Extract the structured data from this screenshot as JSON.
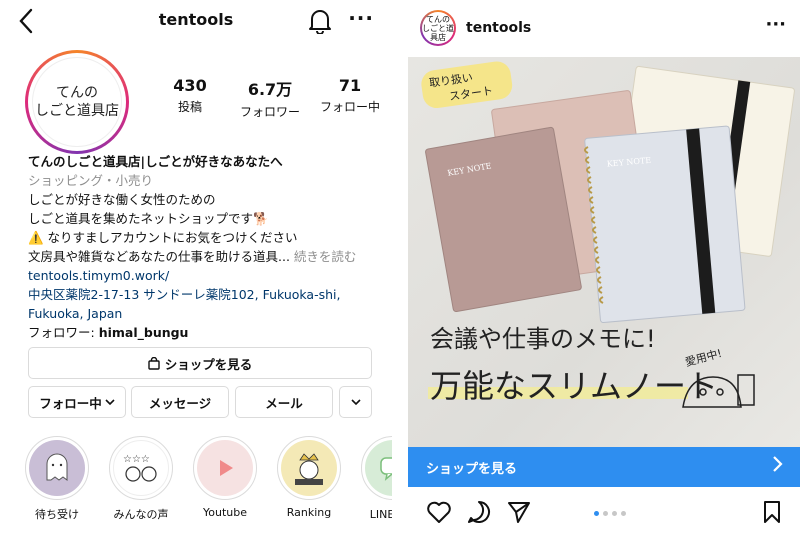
{
  "profile": {
    "username": "tentools",
    "avatar_text": "てんの\nしごと道具店",
    "stats": [
      {
        "num": "430",
        "label": "投稿"
      },
      {
        "num": "6.7万",
        "label": "フォロワー"
      },
      {
        "num": "71",
        "label": "フォロー中"
      }
    ],
    "bio": {
      "name": "てんのしごと道具店|しごとが好きなあなたへ",
      "category": "ショッピング・小売り",
      "line1": "しごとが好きな働く女性のための",
      "line2": "しごと道具を集めたネットショップです🐕",
      "line3": "⚠️ なりすましアカウントにお気をつけください",
      "line4": "文房具や雑貨などあなたの仕事を助ける道具...",
      "more": "続きを読む",
      "link": "tentools.timym0.work/",
      "address1": "中央区薬院2-17-13 サンドーレ薬院102, Fukuoka-shi,",
      "address2": "Fukuoka, Japan",
      "followed_prefix": "フォロワー: ",
      "followed_user": "himal_bungu"
    },
    "buttons": {
      "shop": "ショップを見る",
      "following": "フォロー中",
      "message": "メッセージ",
      "mail": "メール"
    },
    "highlights": [
      {
        "label": "待ち受け"
      },
      {
        "label": "みんなの声"
      },
      {
        "label": "Youtube"
      },
      {
        "label": "Ranking"
      },
      {
        "label": "LINEスタ"
      }
    ]
  },
  "post": {
    "username": "tentools",
    "avatar_text": "てんの\nしごと道具店",
    "image_text": {
      "note_brand": "KEY NOTE",
      "sticker": "取り扱い\nスタート",
      "headline1": "会議や仕事のメモに!",
      "headline2": "万能なスリムノート",
      "aside": "愛用中!"
    },
    "shop_bar": "ショップを見る",
    "carousel": {
      "total": 4,
      "active": 0
    }
  },
  "colors": {
    "accent": "#2e8ef0",
    "link": "#00376b",
    "muted": "#8e8e8e"
  },
  "icons": [
    "back-icon",
    "bell-icon",
    "more-icon",
    "shop-bag-icon",
    "chevron-down-icon",
    "heart-icon",
    "comment-icon",
    "send-icon",
    "bookmark-icon",
    "chevron-right-icon"
  ]
}
